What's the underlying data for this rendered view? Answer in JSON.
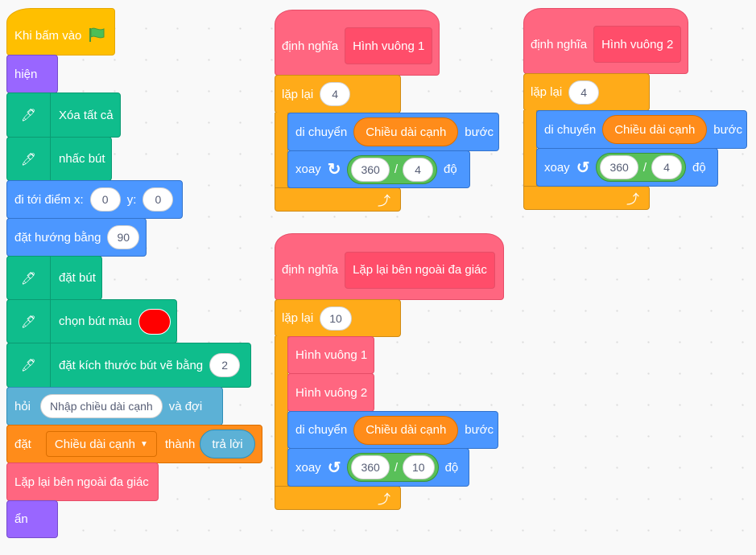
{
  "main_script": {
    "when_flag": "Khi bấm vào",
    "show": "hiện",
    "erase_all": "Xóa tất cả",
    "pen_up": "nhấc bút",
    "goto_label": "đi tới điểm x:",
    "goto_x": "0",
    "goto_y_label": "y:",
    "goto_y": "0",
    "point_dir_label": "đặt hướng bằng",
    "point_dir": "90",
    "pen_down": "đặt bút",
    "pen_color_label": "chọn bút màu",
    "pen_color": "#ff0000",
    "pen_size_label": "đặt kích thước bút vẽ bằng",
    "pen_size": "2",
    "ask_label": "hỏi",
    "ask_text": "Nhập chiều dài cạnh",
    "ask_wait": "và đợi",
    "set_label": "đặt",
    "set_var": "Chiều dài cạnh",
    "set_to": "thành",
    "set_value": "trả lời",
    "call": "Lặp lại bên ngoài đa giác",
    "hide": "ẩn"
  },
  "define1": {
    "define": "định nghĩa",
    "name": "Hình vuông 1",
    "repeat": "lặp lại",
    "times": "4",
    "move": "di chuyển",
    "move_var": "Chiều dài cạnh",
    "steps": "bước",
    "turn": "xoay",
    "direction": "clockwise",
    "a": "360",
    "op": "/",
    "b": "4",
    "deg": "độ"
  },
  "define2": {
    "define": "định nghĩa",
    "name": "Hình vuông 2",
    "repeat": "lặp lại",
    "times": "4",
    "move": "di chuyển",
    "move_var": "Chiều dài cạnh",
    "steps": "bước",
    "turn": "xoay",
    "direction": "counter-clockwise",
    "a": "360",
    "op": "/",
    "b": "4",
    "deg": "độ"
  },
  "define3": {
    "define": "định nghĩa",
    "name": "Lặp lại bên ngoài đa giác",
    "repeat": "lặp lại",
    "times": "10",
    "call1": "Hình vuông 1",
    "call2": "Hình vuông 2",
    "move": "di chuyển",
    "move_var": "Chiều dài cạnh",
    "steps": "bước",
    "turn": "xoay",
    "direction": "counter-clockwise",
    "a": "360",
    "op": "/",
    "b": "10",
    "deg": "độ"
  }
}
